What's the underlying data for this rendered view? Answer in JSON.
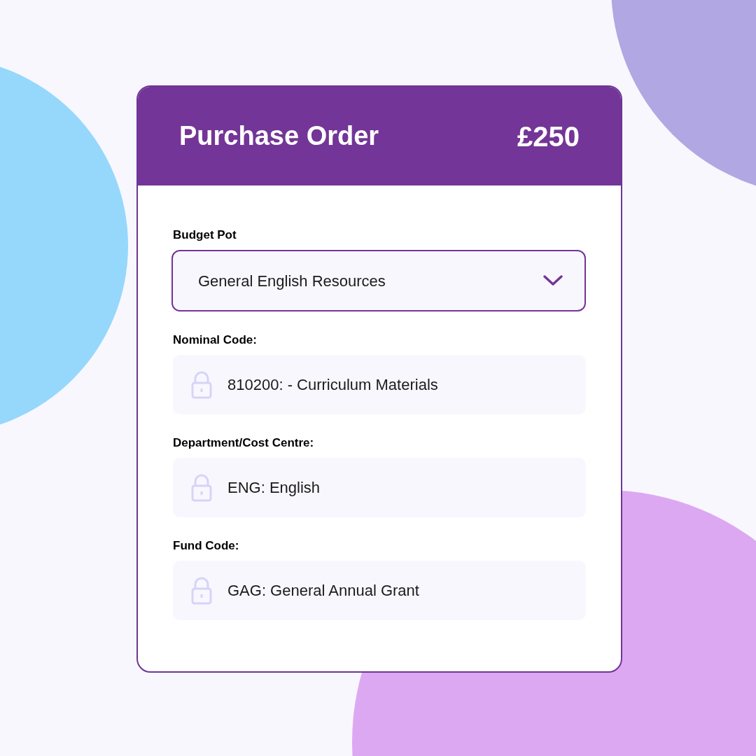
{
  "header": {
    "title": "Purchase Order",
    "amount": "£250"
  },
  "fields": [
    {
      "kind": "select",
      "label": "Budget Pot",
      "value": "General English Resources"
    },
    {
      "kind": "locked",
      "label": "Nominal Code:",
      "value": "810200: - Curriculum Materials"
    },
    {
      "kind": "locked",
      "label": "Department/Cost Centre:",
      "value": "ENG: English"
    },
    {
      "kind": "locked",
      "label": "Fund Code:",
      "value": "GAG: General Annual Grant"
    }
  ]
}
